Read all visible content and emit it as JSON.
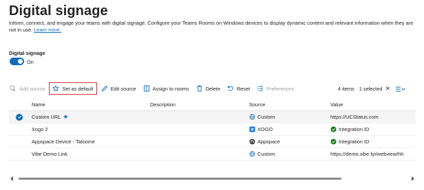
{
  "header": {
    "title": "Digital signage",
    "description": "Inform, connect, and engage your teams with digital signage. Configure your Teams Rooms on Windows devices to display dynamic content and relevant information when they are not in use.",
    "learn_more": "Learn more."
  },
  "toggle": {
    "label": "Digital signage",
    "state": "On",
    "enabled": true
  },
  "toolbar": {
    "add_source": "Add source",
    "set_default": "Set as default",
    "edit_source": "Edit source",
    "assign_rooms": "Assign to rooms",
    "delete": "Delete",
    "reset": "Reset",
    "preferences": "Preferences"
  },
  "summary": {
    "items": "4 items",
    "selected": "1 selected"
  },
  "table": {
    "columns": [
      "Name",
      "Description",
      "Source",
      "Value"
    ],
    "rows": [
      {
        "name": "Custom URL",
        "description": "",
        "source": "Custom",
        "value": "https://UCStatus.com",
        "selected": true,
        "default": true
      },
      {
        "name": "Xogo 2",
        "description": "",
        "source": "XOGO",
        "value": "Integration ID",
        "selected": false
      },
      {
        "name": "Appspace Device - Tatooine",
        "description": "",
        "source": "Appspace",
        "value": "Integration ID",
        "selected": false
      },
      {
        "name": "Vibe Demo Link",
        "description": "",
        "source": "Custom",
        "value": "https://demo.vibe.fyi/webview/hh",
        "selected": false
      }
    ]
  },
  "colors": {
    "accent": "#0f6cbd",
    "highlight_border": "#d13438",
    "success": "#107c10",
    "xogo": "#1b74e4"
  }
}
